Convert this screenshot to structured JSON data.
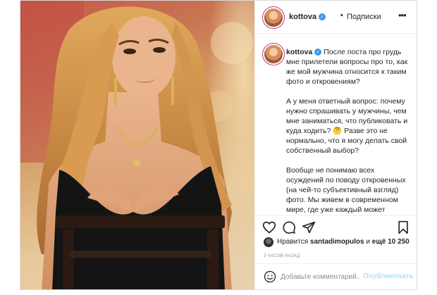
{
  "post": {
    "username": "kottova",
    "follow_label": "Подписки",
    "caption": [
      "После поста про грудь мне прилетели вопросы про то, как же мой мужчина относится к таким фото и откровениям?",
      "А у меня ответный вопрос: почему нужно спрашивать у мужчины, чем мне заниматься, что публиковать и куда ходить? 🤔 Разве это не нормально, что я могу делать свой собственный выбор?",
      "Вообще не понимаю всех осуждений по поводу откровенных (на чей-то субъективный взгляд) фото. Мы живем в современном мире, где уже каждый может выпустить свою валюту, заморозить яйцеклетки и вот вот начнём"
    ],
    "likes": {
      "prefix": "Нравится",
      "user": "santadimopulos",
      "connector": "и",
      "count": "ещё 10 250"
    },
    "timestamp": "3 ЧАСОВ НАЗАД",
    "comment_placeholder": "Добавьте комментарий...",
    "publish_label": "Опубликовать"
  },
  "icons": {
    "verified": "verified-badge-icon",
    "more": "more-options-icon",
    "like": "heart-icon",
    "comment": "comment-icon",
    "share": "send-icon",
    "save": "bookmark-icon",
    "emoji": "emoji-icon"
  },
  "colors": {
    "link_blue": "#3897f0",
    "publish_disabled": "#b2dffc",
    "muted_text": "#8e8e8e",
    "border": "#dbdbdb"
  }
}
